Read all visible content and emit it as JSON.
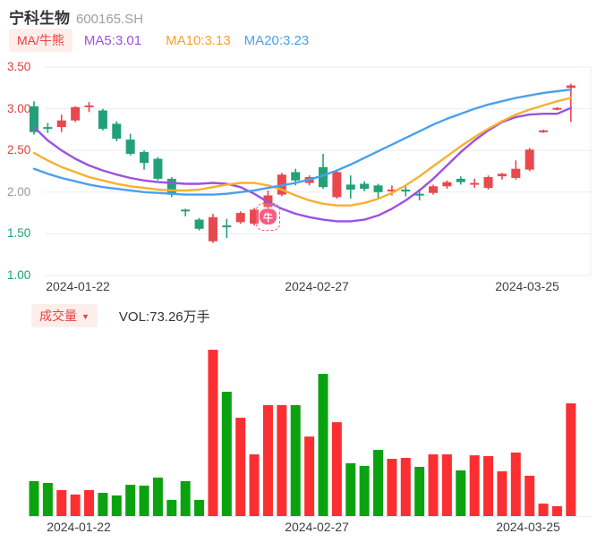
{
  "header": {
    "stock_name": "宁科生物",
    "stock_code": "600165.SH"
  },
  "indicators": {
    "ma_badge": "MA/牛熊",
    "ma5_label": "MA5:3.01",
    "ma10_label": "MA10:3.13",
    "ma20_label": "MA20:3.23"
  },
  "volume_header": {
    "badge": "成交量",
    "dropdown_glyph": "▼",
    "vol_label": "VOL:73.26万手"
  },
  "marker": {
    "glyph": "牛",
    "candle_index": 17
  },
  "colors": {
    "candle_up": "#e8484e",
    "candle_down": "#22a179",
    "vol_up": "#fb2f31",
    "vol_down": "#0aa30f",
    "ma5": "#9b52e1",
    "ma10": "#f8b030",
    "ma20": "#4aa0ee",
    "tick_up": "#e0403c",
    "tick_down": "#18a274",
    "tick_flat": "#999999",
    "grid": "#e8edf4",
    "baseline": "#ececec",
    "accent_red": "#e8403c",
    "marker_pink": "#f8537e"
  },
  "chart_data": [
    {
      "type": "candlestick",
      "title": "宁科生物 600165.SH 日K",
      "ylim": [
        1.0,
        3.5
      ],
      "y_ticks": [
        {
          "label": "3.50",
          "value": 3.5,
          "tone": "up"
        },
        {
          "label": "3.00",
          "value": 3.0,
          "tone": "up"
        },
        {
          "label": "2.50",
          "value": 2.5,
          "tone": "up"
        },
        {
          "label": "2.00",
          "value": 2.0,
          "tone": "flat"
        },
        {
          "label": "1.50",
          "value": 1.5,
          "tone": "down"
        },
        {
          "label": "1.00",
          "value": 1.0,
          "tone": "down"
        }
      ],
      "x_labels": [
        "2024-01-22",
        "2024-02-27",
        "2024-03-25"
      ],
      "x_label_positions": [
        87,
        354,
        589
      ],
      "legend": [
        "MA5",
        "MA10",
        "MA20"
      ],
      "candles_ohlc_dir": [
        [
          3.03,
          3.09,
          2.69,
          2.72,
          "d"
        ],
        [
          2.78,
          2.83,
          2.71,
          2.77,
          "d"
        ],
        [
          2.78,
          2.93,
          2.72,
          2.86,
          "u"
        ],
        [
          2.86,
          3.03,
          2.84,
          3.02,
          "u"
        ],
        [
          3.02,
          3.08,
          2.96,
          3.04,
          "u"
        ],
        [
          2.98,
          3.0,
          2.74,
          2.76,
          "d"
        ],
        [
          2.82,
          2.85,
          2.61,
          2.64,
          "d"
        ],
        [
          2.63,
          2.7,
          2.44,
          2.46,
          "d"
        ],
        [
          2.48,
          2.5,
          2.27,
          2.35,
          "d"
        ],
        [
          2.4,
          2.42,
          2.14,
          2.16,
          "d"
        ],
        [
          2.16,
          2.18,
          1.94,
          1.97,
          "d"
        ],
        [
          1.79,
          1.8,
          1.71,
          1.78,
          "d"
        ],
        [
          1.67,
          1.69,
          1.54,
          1.56,
          "d"
        ],
        [
          1.41,
          1.74,
          1.39,
          1.7,
          "u"
        ],
        [
          1.6,
          1.68,
          1.45,
          1.58,
          "d"
        ],
        [
          1.64,
          1.77,
          1.62,
          1.75,
          "u"
        ],
        [
          1.62,
          1.81,
          1.6,
          1.79,
          "u"
        ],
        [
          1.82,
          2.02,
          1.8,
          1.96,
          "u"
        ],
        [
          1.97,
          2.23,
          1.95,
          2.21,
          "u"
        ],
        [
          2.24,
          2.28,
          2.08,
          2.14,
          "d"
        ],
        [
          2.11,
          2.2,
          2.08,
          2.18,
          "u"
        ],
        [
          2.3,
          2.46,
          2.04,
          2.06,
          "d"
        ],
        [
          1.94,
          2.26,
          1.92,
          2.24,
          "u"
        ],
        [
          2.09,
          2.2,
          1.92,
          2.03,
          "d"
        ],
        [
          2.1,
          2.13,
          2.01,
          2.04,
          "d"
        ],
        [
          2.08,
          2.1,
          1.93,
          2.0,
          "d"
        ],
        [
          2.01,
          2.08,
          1.96,
          2.03,
          "u"
        ],
        [
          2.03,
          2.09,
          1.95,
          2.01,
          "d"
        ],
        [
          1.98,
          2.04,
          1.9,
          1.96,
          "d"
        ],
        [
          1.99,
          2.09,
          1.97,
          2.07,
          "u"
        ],
        [
          2.07,
          2.14,
          2.04,
          2.12,
          "u"
        ],
        [
          2.16,
          2.19,
          2.09,
          2.12,
          "d"
        ],
        [
          2.1,
          2.16,
          2.05,
          2.11,
          "u"
        ],
        [
          2.05,
          2.2,
          2.03,
          2.18,
          "u"
        ],
        [
          2.19,
          2.23,
          2.15,
          2.22,
          "u"
        ],
        [
          2.17,
          2.38,
          2.15,
          2.28,
          "u"
        ],
        [
          2.27,
          2.53,
          2.25,
          2.51,
          "u"
        ],
        [
          2.72,
          2.75,
          2.71,
          2.74,
          "u"
        ],
        [
          2.99,
          3.02,
          2.98,
          3.01,
          "u"
        ],
        [
          3.25,
          3.3,
          2.84,
          3.28,
          "u"
        ]
      ],
      "series": [
        {
          "name": "MA5",
          "values": [
            2.78,
            2.62,
            2.5,
            2.4,
            2.32,
            2.26,
            2.21,
            2.17,
            2.14,
            2.12,
            2.11,
            2.1,
            2.1,
            2.11,
            2.1,
            2.06,
            1.98,
            1.88,
            1.8,
            1.74,
            1.7,
            1.67,
            1.65,
            1.65,
            1.67,
            1.72,
            1.8,
            1.9,
            2.02,
            2.16,
            2.32,
            2.48,
            2.62,
            2.74,
            2.84,
            2.9,
            2.93,
            2.94,
            2.94,
            3.01
          ]
        },
        {
          "name": "MA10",
          "values": [
            2.47,
            2.38,
            2.3,
            2.24,
            2.18,
            2.14,
            2.1,
            2.07,
            2.05,
            2.03,
            2.02,
            2.02,
            2.03,
            2.06,
            2.09,
            2.11,
            2.11,
            2.08,
            2.03,
            1.96,
            1.9,
            1.86,
            1.84,
            1.84,
            1.87,
            1.92,
            1.99,
            2.08,
            2.19,
            2.31,
            2.43,
            2.55,
            2.66,
            2.76,
            2.85,
            2.93,
            2.99,
            3.04,
            3.09,
            3.13
          ]
        },
        {
          "name": "MA20",
          "values": [
            2.28,
            2.22,
            2.17,
            2.13,
            2.09,
            2.06,
            2.04,
            2.02,
            2.0,
            1.99,
            1.98,
            1.97,
            1.97,
            1.97,
            1.98,
            2.0,
            2.02,
            2.05,
            2.08,
            2.11,
            2.15,
            2.2,
            2.26,
            2.33,
            2.41,
            2.49,
            2.57,
            2.65,
            2.73,
            2.81,
            2.88,
            2.94,
            3.0,
            3.05,
            3.09,
            3.13,
            3.16,
            3.19,
            3.21,
            3.23
          ]
        }
      ]
    },
    {
      "type": "bar",
      "title": "成交量",
      "unit": "万手",
      "latest_volume_label": "VOL:73.26万手",
      "x_labels": [
        "2024-01-22",
        "2024-02-27",
        "2024-03-25"
      ],
      "x_label_positions": [
        88,
        354,
        590
      ],
      "values": [
        22.7,
        21.5,
        16.9,
        14.0,
        16.9,
        15.1,
        13.4,
        20.3,
        19.8,
        25.0,
        10.5,
        22.7,
        10.5,
        108.1,
        80.8,
        63.9,
        40.1,
        72.1,
        72.1,
        72.1,
        51.7,
        92.4,
        61.0,
        34.3,
        32.6,
        43.0,
        37.2,
        37.8,
        32.0,
        40.1,
        40.1,
        29.7,
        39.5,
        39.0,
        29.1,
        41.3,
        26.2,
        8.1,
        6.4,
        73.26
      ],
      "dirs": [
        "d",
        "d",
        "u",
        "u",
        "u",
        "d",
        "d",
        "d",
        "d",
        "d",
        "d",
        "d",
        "d",
        "u",
        "d",
        "u",
        "u",
        "u",
        "u",
        "d",
        "u",
        "d",
        "u",
        "d",
        "d",
        "d",
        "u",
        "u",
        "d",
        "u",
        "u",
        "d",
        "u",
        "u",
        "u",
        "u",
        "u",
        "u",
        "u",
        "u"
      ]
    }
  ]
}
